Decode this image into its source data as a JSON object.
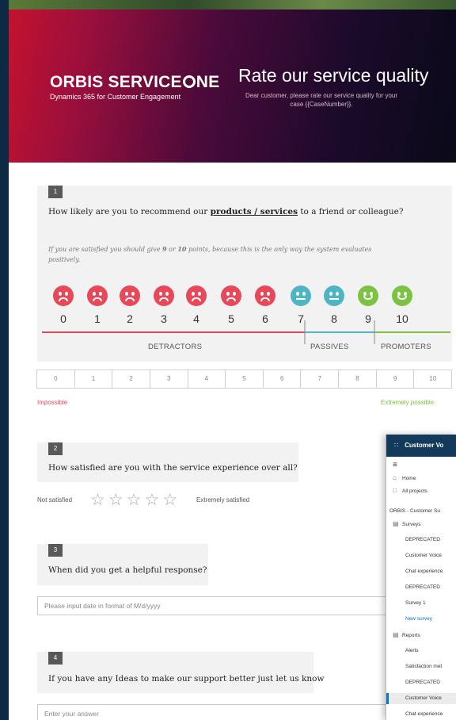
{
  "banner": {
    "brand_name": "ORBIS SERVICE",
    "brand_name_tail": "NE",
    "brand_sub": "Dynamics 365 for Customer Engagement",
    "title": "Rate our service quality",
    "description": "Dear customer, please rate our service quality for your case {{CaseNumber}}."
  },
  "q1": {
    "number": "1",
    "text_pre": "How likely are you to recommend our ",
    "text_em": "products / services",
    "text_post": " to a friend or colleague?",
    "hint_1": "If you are satisfied you should give ",
    "hint_9": "9",
    "hint_or": " or ",
    "hint_10": "10",
    "hint_2": " points, because this is the only way the system evaluates",
    "hint_3": "positively.",
    "scores": [
      "0",
      "1",
      "2",
      "3",
      "4",
      "5",
      "6",
      "7",
      "8",
      "9",
      "10"
    ],
    "segments": {
      "detractors": "DETRACTORS",
      "passives": "PASSIVES",
      "promoters": "PROMOTERS"
    },
    "scale_options": [
      "0",
      "1",
      "2",
      "3",
      "4",
      "5",
      "6",
      "7",
      "8",
      "9",
      "10"
    ],
    "low_label": "Impossible",
    "high_label": "Extremely possible",
    "colors": {
      "detractor": "#e8495a",
      "passive": "#4fb5c4",
      "promoter": "#7cc243"
    }
  },
  "q2": {
    "number": "2",
    "text": "How satisfied are you with the service experience over all?",
    "low_label": "Not satisfied",
    "high_label": "Extremely satisfied",
    "rating_max": 5,
    "rating_value": 0
  },
  "q3": {
    "number": "3",
    "text": "When did you get a helpful response?",
    "placeholder": "Please input date in format of M/d/yyyy"
  },
  "q4": {
    "number": "4",
    "text": "If you have any Ideas to make our support better just let us know",
    "placeholder": "Enter your answer"
  },
  "customer_voice": {
    "title": "Customer Vo",
    "menu_icon": "hamburger-icon",
    "home": "Home",
    "all_projects": "All projects",
    "project": "ORBIS - Customer Su",
    "surveys": "Surveys",
    "survey_items": [
      "DEPRECATED",
      "Customer Voice",
      "Chat experience",
      "DEPRECATED",
      "Survey 1"
    ],
    "new_survey": "New survey",
    "reports": "Reports",
    "report_items": [
      "Alerts",
      "Satisfaction met",
      "DEPRECATED",
      "Customer Voice",
      "Chat experience"
    ]
  }
}
